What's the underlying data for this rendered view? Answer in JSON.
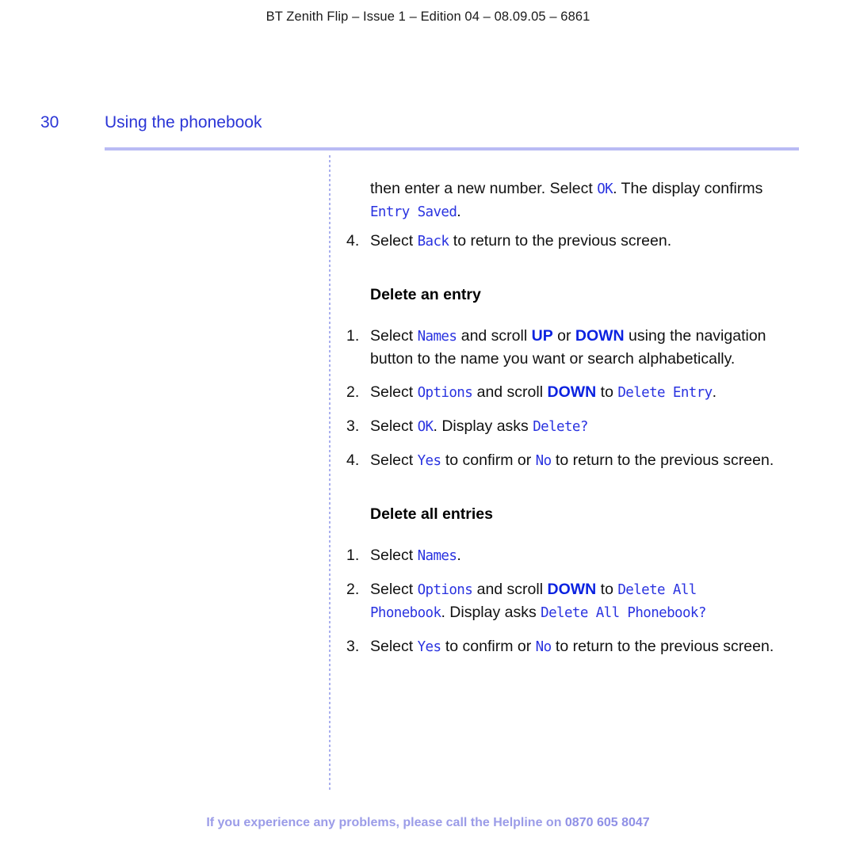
{
  "document": {
    "running_header": "BT Zenith Flip – Issue 1 – Edition 04 – 08.09.05 – 6861",
    "page_number": "30",
    "page_title": "Using the phonebook",
    "footer_text": "If you experience any problems, please call the Helpline on ",
    "footer_phone": "0870 605 8047"
  },
  "colors": {
    "heading_blue": "#2b35d6",
    "lcd_blue": "#2a33e0",
    "key_blue": "#0b22e0",
    "rule_lilac": "#b9bbf4",
    "footer_lilac": "#9b9ce8",
    "body_black": "#111111"
  },
  "content": {
    "continued_paragraph": {
      "part1": "then enter a new number. Select ",
      "lcd1": "OK",
      "part2": ". The display confirms ",
      "lcd2": "Entry Saved",
      "part3": "."
    },
    "continued_step": {
      "num": "4.",
      "part1": "Select ",
      "lcd1": "Back",
      "part2": " to return to the previous screen."
    },
    "sections": [
      {
        "heading": "Delete an entry",
        "steps": [
          {
            "num": "1.",
            "part1": "Select ",
            "lcd1": "Names",
            "part2": " and scroll ",
            "key1": "UP",
            "part3": " or ",
            "key2": "DOWN",
            "part4": " using the navigation button to the name you want or search alphabetically."
          },
          {
            "num": "2.",
            "part1": "Select ",
            "lcd1": "Options",
            "part2": " and scroll ",
            "key1": "DOWN",
            "part3": " to ",
            "lcd2": "Delete Entry",
            "part4": "."
          },
          {
            "num": "3.",
            "part1": "Select ",
            "lcd1": "OK",
            "part2": ". Display asks ",
            "lcd2": "Delete?",
            "part3": ""
          },
          {
            "num": "4.",
            "part1": "Select ",
            "lcd1": "Yes",
            "part2": " to confirm or ",
            "lcd2": "No",
            "part3": " to return to the previous screen."
          }
        ]
      },
      {
        "heading": "Delete all entries",
        "steps": [
          {
            "num": "1.",
            "part1": "Select ",
            "lcd1": "Names",
            "part2": "."
          },
          {
            "num": "2.",
            "part1": "Select ",
            "lcd1": "Options",
            "part2": " and scroll ",
            "key1": "DOWN",
            "part3": " to ",
            "lcd2": "Delete All Phonebook",
            "part4": ". Display asks ",
            "lcd3": "Delete All Phonebook?",
            "part5": ""
          },
          {
            "num": "3.",
            "part1": "Select ",
            "lcd1": "Yes",
            "part2": " to confirm or ",
            "lcd2": "No",
            "part3": " to return to the previous screen."
          }
        ]
      }
    ]
  }
}
